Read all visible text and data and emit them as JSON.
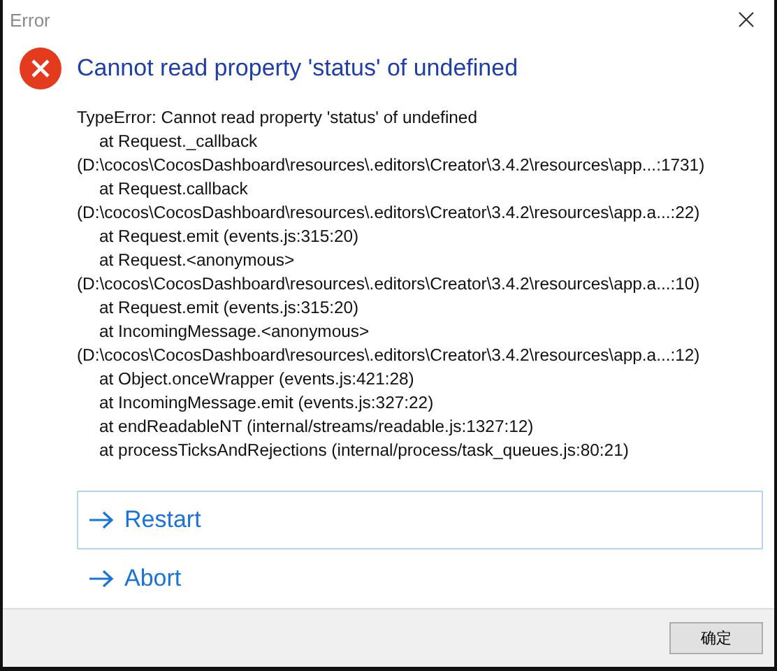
{
  "window": {
    "title": "Error"
  },
  "heading": "Cannot read property 'status' of undefined",
  "details": [
    {
      "kind": "line",
      "text": "TypeError: Cannot read property 'status' of undefined"
    },
    {
      "kind": "frame",
      "text": "at Request._callback"
    },
    {
      "kind": "line",
      "text": "(D:\\cocos\\CocosDashboard\\resources\\.editors\\Creator\\3.4.2\\resources\\app...:1731)"
    },
    {
      "kind": "frame",
      "text": "at Request.callback"
    },
    {
      "kind": "line",
      "text": "(D:\\cocos\\CocosDashboard\\resources\\.editors\\Creator\\3.4.2\\resources\\app.a...:22)"
    },
    {
      "kind": "frame",
      "text": "at Request.emit (events.js:315:20)"
    },
    {
      "kind": "frame",
      "text": "at Request.<anonymous>"
    },
    {
      "kind": "line",
      "text": "(D:\\cocos\\CocosDashboard\\resources\\.editors\\Creator\\3.4.2\\resources\\app.a...:10)"
    },
    {
      "kind": "frame",
      "text": "at Request.emit (events.js:315:20)"
    },
    {
      "kind": "frame",
      "text": "at IncomingMessage.<anonymous>"
    },
    {
      "kind": "line",
      "text": "(D:\\cocos\\CocosDashboard\\resources\\.editors\\Creator\\3.4.2\\resources\\app.a...:12)"
    },
    {
      "kind": "frame",
      "text": "at Object.onceWrapper (events.js:421:28)"
    },
    {
      "kind": "frame",
      "text": "at IncomingMessage.emit (events.js:327:22)"
    },
    {
      "kind": "frame",
      "text": "at endReadableNT (internal/streams/readable.js:1327:12)"
    },
    {
      "kind": "frame",
      "text": "at processTicksAndRejections (internal/process/task_queues.js:80:21)"
    }
  ],
  "options": [
    {
      "label": "Restart",
      "selected": true
    },
    {
      "label": "Abort",
      "selected": false
    }
  ],
  "buttons": [
    "确定"
  ]
}
